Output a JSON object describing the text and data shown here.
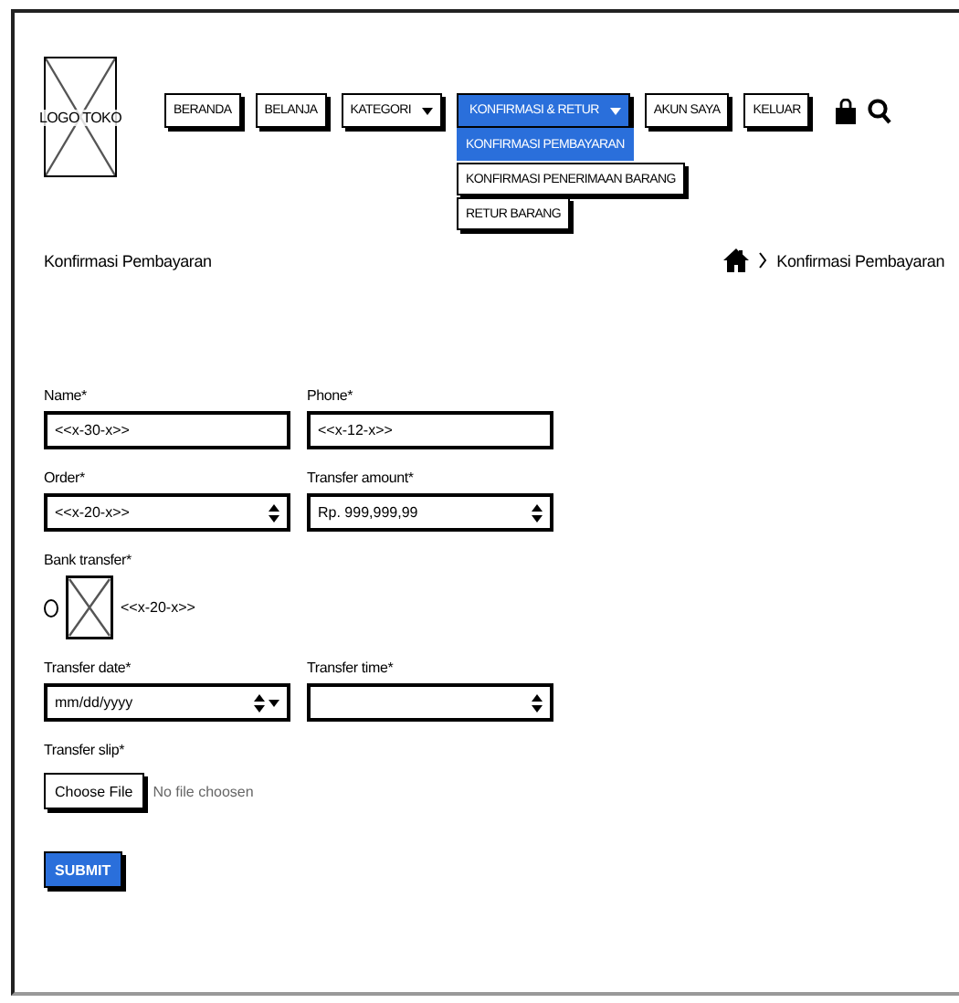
{
  "header": {
    "logo": "LOGO TOKO",
    "nav": [
      {
        "label": "BERANDA",
        "kind": "button",
        "selected": false
      },
      {
        "label": "BELANJA",
        "kind": "button",
        "selected": false
      },
      {
        "label": "KATEGORI",
        "kind": "dropdown",
        "selected": false
      },
      {
        "label": "KONFIRMASI & RETUR",
        "kind": "dropdown",
        "selected": true
      },
      {
        "label": "AKUN SAYA",
        "kind": "button",
        "selected": false
      },
      {
        "label": "KELUAR",
        "kind": "button",
        "selected": false
      }
    ],
    "dropdown_menu": [
      {
        "label": "KONFIRMASI PEMBAYARAN",
        "selected": true
      },
      {
        "label": "KONFIRMASI PENERIMAAN BARANG",
        "selected": false
      },
      {
        "label": "RETUR BARANG",
        "selected": false
      }
    ]
  },
  "page_title": "Konfirmasi Pembayaran",
  "breadcrumb": {
    "current": "Konfirmasi Pembayaran"
  },
  "form": {
    "rows": [
      [
        {
          "label": "Name*",
          "kind": "text",
          "value": "<<x-30-x>>"
        },
        {
          "label": "Phone*",
          "kind": "text",
          "value": "<<x-12-x>>"
        }
      ],
      [
        {
          "label": "Order*",
          "kind": "select",
          "value": "<<x-20-x>>"
        },
        {
          "label": "Transfer amount*",
          "kind": "select",
          "value": "Rp. 999,999,99"
        }
      ],
      [
        {
          "label": "Bank transfer*",
          "kind": "radio-image",
          "selected": false,
          "option": "<<x-20-x>>"
        }
      ],
      [
        {
          "label": "Transfer date*",
          "kind": "date",
          "value": "mm/dd/yyyy"
        },
        {
          "label": "Transfer time*",
          "kind": "select"
        }
      ],
      [
        {
          "label": "Transfer slip*",
          "kind": "file",
          "button": "Choose File",
          "status": "No file choosen"
        }
      ]
    ],
    "submit": "SUBMIT"
  }
}
